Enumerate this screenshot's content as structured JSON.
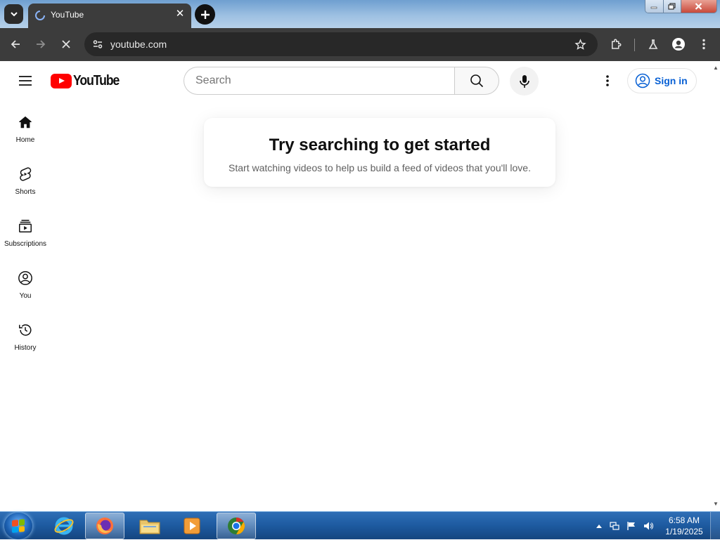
{
  "browser": {
    "tab_title": "YouTube",
    "url": "youtube.com",
    "tab_list_icon": "chevron-down-icon",
    "new_tab_icon": "plus-icon",
    "window_buttons": [
      "minimize",
      "maximize",
      "close"
    ]
  },
  "masthead": {
    "logo_text": "YouTube",
    "search_placeholder": "Search",
    "sign_in_label": "Sign in"
  },
  "guide": {
    "items": [
      {
        "label": "Home",
        "icon": "home-icon"
      },
      {
        "label": "Shorts",
        "icon": "shorts-icon"
      },
      {
        "label": "Subscriptions",
        "icon": "subscriptions-icon"
      },
      {
        "label": "You",
        "icon": "you-icon"
      },
      {
        "label": "History",
        "icon": "history-icon"
      }
    ]
  },
  "message": {
    "title": "Try searching to get started",
    "subtitle": "Start watching videos to help us build a feed of videos that you'll love."
  },
  "taskbar": {
    "pinned": [
      "internet-explorer-icon",
      "firefox-icon",
      "file-explorer-icon",
      "media-player-icon",
      "chrome-icon"
    ],
    "time": "6:58 AM",
    "date": "1/19/2025"
  },
  "colors": {
    "youtube_red": "#ff0000",
    "link_blue": "#065fd4",
    "browser_dark": "#3c3c3c"
  }
}
